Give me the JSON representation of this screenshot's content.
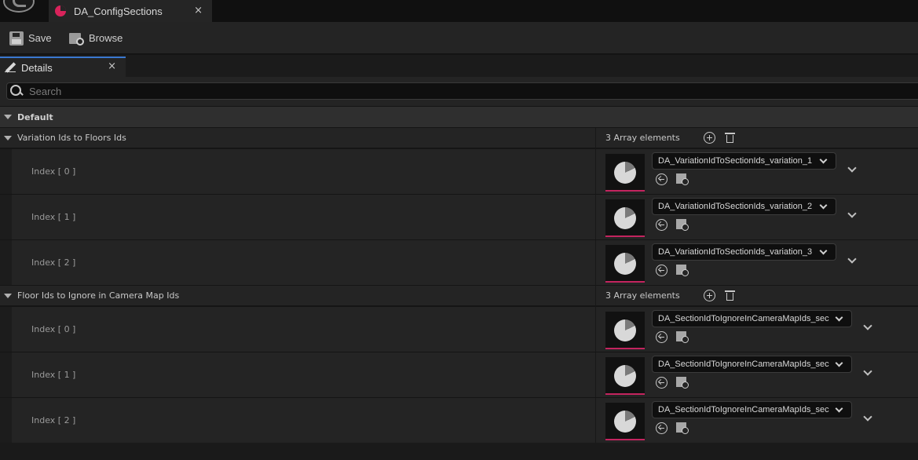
{
  "window": {
    "tab_title": "DA_ConfigSections",
    "tab_close": "×"
  },
  "toolbar": {
    "save_label": "Save",
    "browse_label": "Browse"
  },
  "details_panel": {
    "tab_label": "Details",
    "tab_close": "×",
    "search": {
      "placeholder": "Search",
      "value": ""
    },
    "category": "Default",
    "arrays": [
      {
        "name": "Variation Ids to Floors Ids",
        "count_label": "3 Array elements",
        "elements": [
          {
            "index_label": "Index [ 0 ]",
            "asset": "DA_VariationIdToSectionIds_variation_1"
          },
          {
            "index_label": "Index [ 1 ]",
            "asset": "DA_VariationIdToSectionIds_variation_2"
          },
          {
            "index_label": "Index [ 2 ]",
            "asset": "DA_VariationIdToSectionIds_variation_3"
          }
        ]
      },
      {
        "name": "Floor Ids to Ignore in Camera Map Ids",
        "count_label": "3 Array elements",
        "elements": [
          {
            "index_label": "Index [ 0 ]",
            "asset": "DA_SectionIdToIgnoreInCameraMapIds_sec"
          },
          {
            "index_label": "Index [ 1 ]",
            "asset": "DA_SectionIdToIgnoreInCameraMapIds_sec"
          },
          {
            "index_label": "Index [ 2 ]",
            "asset": "DA_SectionIdToIgnoreInCameraMapIds_sec"
          }
        ]
      }
    ]
  },
  "colors": {
    "asset_accent": "#c3245f",
    "tab_icon": "#d9235b",
    "active_tab_border": "#3a78d0"
  },
  "icons": {
    "logo": "unreal-logo-icon",
    "tab": "data-asset-icon",
    "save": "floppy-disk-icon",
    "browse": "folder-search-icon",
    "details": "pencil-icon",
    "search": "magnifier-icon",
    "add": "add-circle-icon",
    "remove_all": "trash-icon",
    "use_selected": "use-selected-arrow-icon",
    "browse_asset": "browse-folder-icon",
    "expand": "chevron-down-icon"
  }
}
